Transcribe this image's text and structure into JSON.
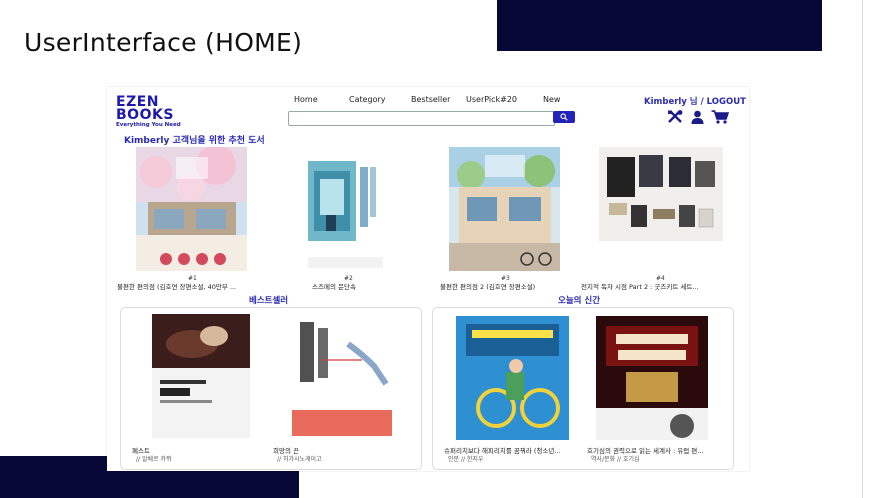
{
  "slide_title": "UserInterface (HOME)",
  "header": {
    "logo_line1": "EZEN",
    "logo_line2": "BOOKS",
    "logo_tagline": "Everything You Need",
    "nav": [
      "Home",
      "Category",
      "Bestseller",
      "UserPick#20",
      "New"
    ],
    "search": {
      "value": "",
      "placeholder": ""
    },
    "user_text": "Kimberly 님 / LOGOUT",
    "icons": [
      "tools-icon",
      "user-icon",
      "cart-icon"
    ]
  },
  "recommend": {
    "title": "Kimberly 고객님을 위한 추천 도서",
    "items": [
      {
        "rank": "#1",
        "title": "불편한 편의점 (김호연 장편소설, 40만부 ..."
      },
      {
        "rank": "#2",
        "title": "스즈메의 문단속"
      },
      {
        "rank": "#3",
        "title": "불편한 편의점 2 (김호연 장편소설)"
      },
      {
        "rank": "#4",
        "title": "전지적 독자 시점 Part 2 : 굿즈키트 세트..."
      }
    ]
  },
  "bestseller": {
    "title": "베스트셀러",
    "items": [
      {
        "title": "페스트",
        "author": "// 알베르 카뮈"
      },
      {
        "title": "희망의 끈",
        "author": "// 히가시노게이고"
      }
    ]
  },
  "new_today": {
    "title": "오늘의 신간",
    "items": [
      {
        "title": "슈퍼리치보다 해피리치를 꿈꿔라 (청소년...",
        "author": "인문 // 한지우"
      },
      {
        "title": "호기심의 권력으로 읽는 세계사 : 유럽 편...",
        "author": "역사/문화 // 호기심"
      }
    ]
  },
  "colors": {
    "accent": "#2a2ab0",
    "deco": "#070738"
  }
}
